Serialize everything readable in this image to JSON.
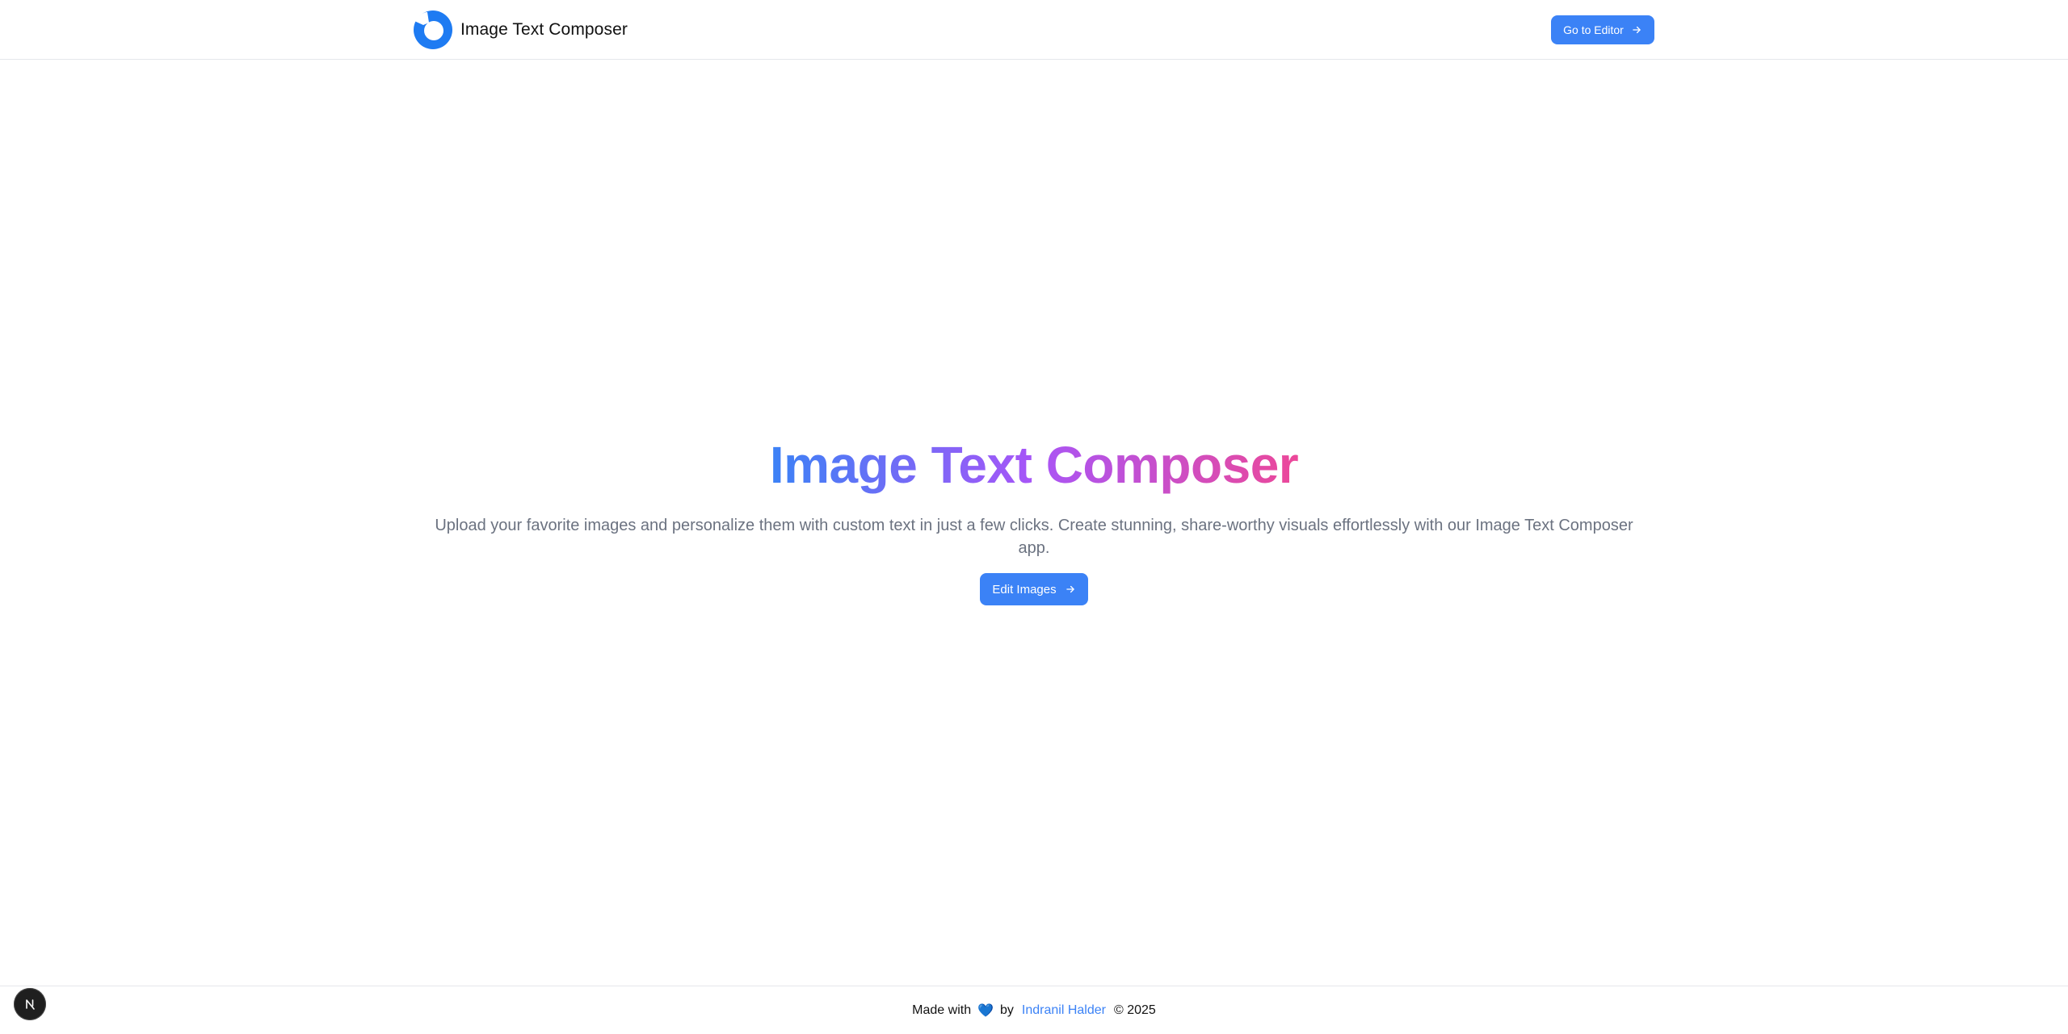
{
  "header": {
    "brand_title": "Image Text Composer",
    "cta_label": "Go to Editor"
  },
  "hero": {
    "title": "Image Text Composer",
    "description": "Upload your favorite images and personalize them with custom text in just a few clicks. Create stunning, share-worthy visuals effortlessly with our Image Text Composer app.",
    "cta_label": "Edit Images"
  },
  "footer": {
    "made_with": "Made with",
    "heart": "💙",
    "by": "by",
    "author": "Indranil Halder",
    "copyright": "© 2025"
  },
  "dev_badge": {
    "letter": "N"
  },
  "colors": {
    "accent": "#3b82f6",
    "gradient_start": "#3b82f6",
    "gradient_mid": "#a855f7",
    "gradient_end": "#ec4899",
    "muted_text": "#6b7280",
    "border": "#e5e7eb"
  },
  "icons": {
    "logo": "brand-logo-icon",
    "arrow": "arrow-right-icon",
    "heart": "blue-heart-icon",
    "dev": "nextjs-icon"
  }
}
